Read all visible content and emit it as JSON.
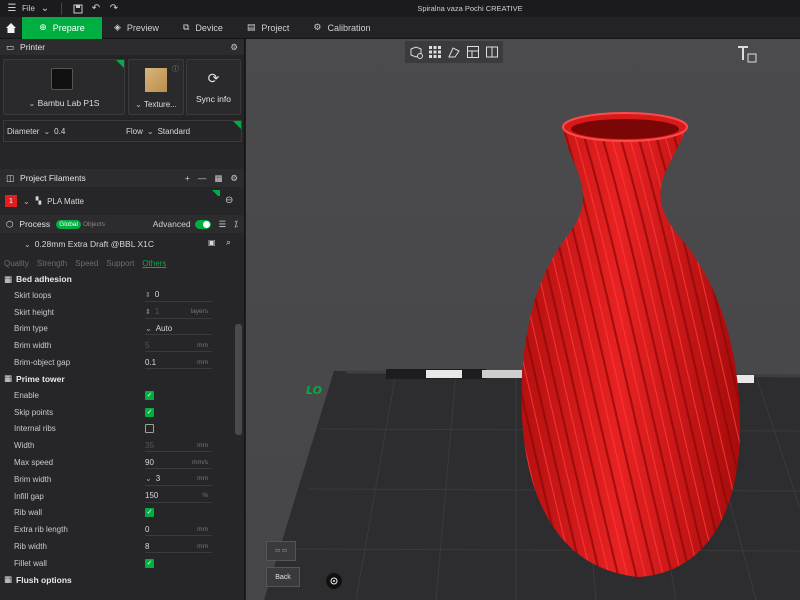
{
  "titlebar": {
    "file_label": "File",
    "window_title": "Spiralna vaza Pochi CREATIVE"
  },
  "tabs": [
    {
      "label": "Prepare",
      "icon": "prepare-icon"
    },
    {
      "label": "Preview",
      "icon": "preview-icon"
    },
    {
      "label": "Device",
      "icon": "device-icon"
    },
    {
      "label": "Project",
      "icon": "project-icon"
    },
    {
      "label": "Calibration",
      "icon": "calibration-icon"
    }
  ],
  "printer": {
    "header": "Printer",
    "printer_name": "Bambu Lab P1S",
    "plate_label": "Texture...",
    "sync_label": "Sync info",
    "diameter_label": "Diameter",
    "diameter_value": "0.4",
    "flow_label": "Flow",
    "flow_value": "Standard"
  },
  "filaments": {
    "header": "Project Filaments",
    "items": [
      {
        "index": "1",
        "name": "PLA Matte",
        "color": "#e02020"
      }
    ]
  },
  "process": {
    "header": "Process",
    "global_label": "Global",
    "objects_label": "Objects",
    "advanced_label": "Advanced",
    "preset": "0.28mm Extra Draft @BBL X1C",
    "subtabs": [
      "Quality",
      "Strength",
      "Speed",
      "Support",
      "Others"
    ],
    "active_subtab": "Others"
  },
  "bed_adhesion": {
    "title": "Bed adhesion",
    "params": [
      {
        "label": "Skirt loops",
        "value": "0",
        "unit": "",
        "kind": "spin"
      },
      {
        "label": "Skirt height",
        "value": "1",
        "unit": "layers",
        "kind": "spin-dis"
      },
      {
        "label": "Brim type",
        "value": "Auto",
        "unit": "",
        "kind": "select"
      },
      {
        "label": "Brim width",
        "value": "5",
        "unit": "mm",
        "kind": "dis"
      },
      {
        "label": "Brim-object gap",
        "value": "0.1",
        "unit": "mm",
        "kind": "text"
      }
    ]
  },
  "prime_tower": {
    "title": "Prime tower",
    "params": [
      {
        "label": "Enable",
        "value": "",
        "unit": "",
        "kind": "check-on"
      },
      {
        "label": "Skip points",
        "value": "",
        "unit": "",
        "kind": "check-on"
      },
      {
        "label": "Internal ribs",
        "value": "",
        "unit": "",
        "kind": "check-off"
      },
      {
        "label": "Width",
        "value": "35",
        "unit": "mm",
        "kind": "dis"
      },
      {
        "label": "Max speed",
        "value": "90",
        "unit": "mm/s",
        "kind": "text"
      },
      {
        "label": "Brim width",
        "value": "3",
        "unit": "mm",
        "kind": "select"
      },
      {
        "label": "Infill gap",
        "value": "150",
        "unit": "%",
        "kind": "text"
      },
      {
        "label": "Rib wall",
        "value": "",
        "unit": "",
        "kind": "check-on"
      },
      {
        "label": "Extra rib length",
        "value": "0",
        "unit": "mm",
        "kind": "text"
      },
      {
        "label": "Rib width",
        "value": "8",
        "unit": "mm",
        "kind": "text"
      },
      {
        "label": "Fillet wall",
        "value": "",
        "unit": "",
        "kind": "check-on"
      }
    ]
  },
  "flush": {
    "title": "Flush options"
  },
  "viewport": {
    "back_label": "Back",
    "bed_label": "LO",
    "model_color": "#e01e1e"
  }
}
